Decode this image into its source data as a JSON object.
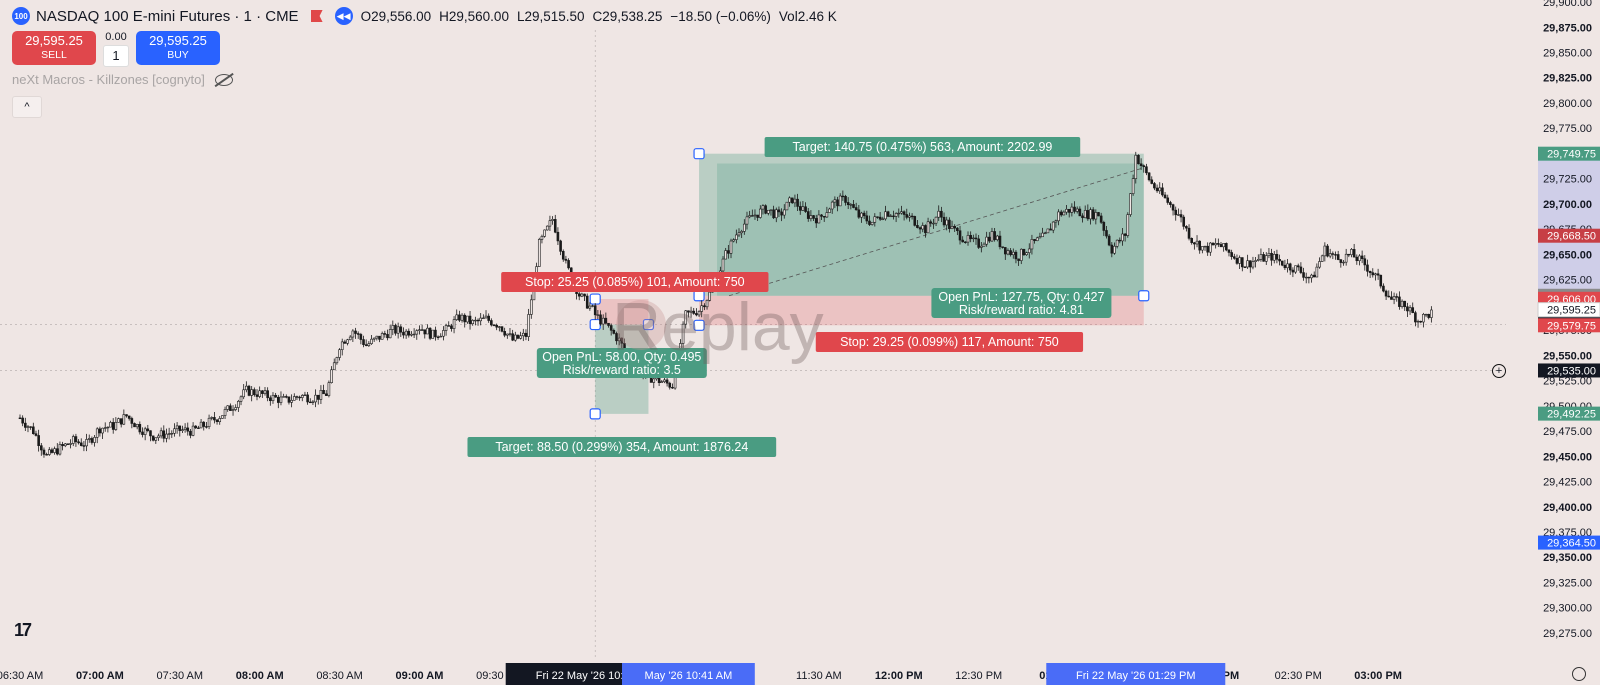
{
  "header": {
    "badge": "100",
    "symbol": "NASDAQ 100 E-mini Futures · 1 · CME",
    "open": "O29,556.00",
    "high": "H29,560.00",
    "low": "L29,515.50",
    "close": "C29,538.25",
    "change": "−18.50 (−0.06%)",
    "volume": "Vol2.46 K"
  },
  "trade_panel": {
    "sell_price": "29,595.25",
    "sell_label": "SELL",
    "spread": "0.00",
    "quantity": "1",
    "buy_price": "29,595.25",
    "buy_label": "BUY"
  },
  "indicator": {
    "name": "neXt Macros - Killzones [cognyto]"
  },
  "collapse_label": "^",
  "watermark": "Replay",
  "logo": "17",
  "colors": {
    "background": "#efe6e4",
    "up": "#1a1a1a",
    "target": "#4a9c82",
    "stop": "#e0474c",
    "accent": "#2962ff"
  },
  "chart_data": {
    "type": "candlestick",
    "y_ticks": [
      "29,900.00",
      "29,875.00",
      "29,850.00",
      "29,825.00",
      "29,800.00",
      "29,775.00",
      "29,750.00",
      "29,725.00",
      "29,700.00",
      "29,675.00",
      "29,650.00",
      "29,625.00",
      "29,600.00",
      "29,575.00",
      "29,550.00",
      "29,525.00",
      "29,500.00",
      "29,475.00",
      "29,450.00",
      "29,425.00",
      "29,400.00",
      "29,375.00",
      "29,350.00",
      "29,325.00",
      "29,300.00",
      "29,275.00"
    ],
    "y_tick_values": [
      29900,
      29875,
      29850,
      29825,
      29800,
      29775,
      29750,
      29725,
      29700,
      29675,
      29650,
      29625,
      29600,
      29575,
      29550,
      29525,
      29500,
      29475,
      29450,
      29425,
      29400,
      29375,
      29350,
      29325,
      29300,
      29275
    ],
    "y_tick_bold": [
      false,
      true,
      false,
      true,
      false,
      false,
      false,
      false,
      true,
      false,
      true,
      false,
      false,
      false,
      true,
      false,
      false,
      false,
      true,
      false,
      true,
      false,
      true,
      false,
      false,
      false
    ],
    "ylim": [
      29268,
      29902
    ],
    "x_ticks": [
      {
        "label": "06:30 AM",
        "t": "06:30",
        "bold": false
      },
      {
        "label": "07:00 AM",
        "t": "07:00",
        "bold": true
      },
      {
        "label": "07:30 AM",
        "t": "07:30",
        "bold": false
      },
      {
        "label": "08:00 AM",
        "t": "08:00",
        "bold": true
      },
      {
        "label": "08:30 AM",
        "t": "08:30",
        "bold": false
      },
      {
        "label": "09:00 AM",
        "t": "09:00",
        "bold": true
      },
      {
        "label": "09:30 AM",
        "t": "09:30",
        "bold": false
      },
      {
        "label": "M",
        "t": "11:00",
        "bold": false
      },
      {
        "label": "11:30 AM",
        "t": "11:30",
        "bold": false
      },
      {
        "label": "12:00 PM",
        "t": "12:00",
        "bold": true
      },
      {
        "label": "12:30 PM",
        "t": "12:30",
        "bold": false
      },
      {
        "label": "01:00 P",
        "t": "13:00",
        "bold": true
      },
      {
        "label": "2:00 PM",
        "t": "14:00",
        "bold": true
      },
      {
        "label": "02:30 PM",
        "t": "14:30",
        "bold": false
      },
      {
        "label": "03:00 PM",
        "t": "15:00",
        "bold": true
      }
    ],
    "x_highlights": [
      {
        "label": "Fri 22 May '26   10:06 AM",
        "t": "10:06",
        "style": "dark"
      },
      {
        "label": "May '26   10:41 AM",
        "t": "10:41",
        "style": "blue"
      },
      {
        "label": "Fri 22 May '26   01:29 PM",
        "t": "13:29",
        "style": "blue"
      }
    ],
    "price_path": [
      [
        "06:30",
        29488
      ],
      [
        "06:35",
        29475
      ],
      [
        "06:40",
        29450
      ],
      [
        "06:45",
        29458
      ],
      [
        "06:50",
        29465
      ],
      [
        "06:55",
        29462
      ],
      [
        "07:00",
        29478
      ],
      [
        "07:05",
        29480
      ],
      [
        "07:10",
        29490
      ],
      [
        "07:15",
        29478
      ],
      [
        "07:20",
        29470
      ],
      [
        "07:25",
        29472
      ],
      [
        "07:30",
        29476
      ],
      [
        "07:35",
        29475
      ],
      [
        "07:40",
        29482
      ],
      [
        "07:45",
        29490
      ],
      [
        "07:50",
        29500
      ],
      [
        "07:55",
        29515
      ],
      [
        "08:00",
        29512
      ],
      [
        "08:05",
        29508
      ],
      [
        "08:10",
        29505
      ],
      [
        "08:15",
        29510
      ],
      [
        "08:20",
        29508
      ],
      [
        "08:25",
        29512
      ],
      [
        "08:30",
        29560
      ],
      [
        "08:35",
        29575
      ],
      [
        "08:40",
        29560
      ],
      [
        "08:45",
        29568
      ],
      [
        "08:50",
        29575
      ],
      [
        "08:55",
        29573
      ],
      [
        "09:00",
        29578
      ],
      [
        "09:05",
        29570
      ],
      [
        "09:10",
        29575
      ],
      [
        "09:15",
        29588
      ],
      [
        "09:20",
        29582
      ],
      [
        "09:25",
        29586
      ],
      [
        "09:30",
        29580
      ],
      [
        "09:35",
        29565
      ],
      [
        "09:40",
        29570
      ],
      [
        "09:45",
        29660
      ],
      [
        "09:50",
        29685
      ],
      [
        "09:55",
        29640
      ],
      [
        "10:00",
        29610
      ],
      [
        "10:05",
        29595
      ],
      [
        "10:06",
        29590
      ],
      [
        "10:10",
        29580
      ],
      [
        "10:15",
        29565
      ],
      [
        "10:20",
        29540
      ],
      [
        "10:25",
        29530
      ],
      [
        "10:30",
        29525
      ],
      [
        "10:35",
        29520
      ],
      [
        "10:40",
        29590
      ],
      [
        "10:45",
        29595
      ],
      [
        "10:50",
        29615
      ],
      [
        "10:55",
        29650
      ],
      [
        "11:00",
        29675
      ],
      [
        "11:05",
        29688
      ],
      [
        "11:10",
        29695
      ],
      [
        "11:15",
        29688
      ],
      [
        "11:20",
        29705
      ],
      [
        "11:25",
        29690
      ],
      [
        "11:30",
        29685
      ],
      [
        "11:35",
        29700
      ],
      [
        "11:40",
        29705
      ],
      [
        "11:45",
        29688
      ],
      [
        "11:50",
        29682
      ],
      [
        "11:55",
        29692
      ],
      [
        "12:00",
        29690
      ],
      [
        "12:05",
        29685
      ],
      [
        "12:10",
        29675
      ],
      [
        "12:15",
        29690
      ],
      [
        "12:20",
        29675
      ],
      [
        "12:25",
        29665
      ],
      [
        "12:30",
        29660
      ],
      [
        "12:35",
        29670
      ],
      [
        "12:40",
        29655
      ],
      [
        "12:45",
        29648
      ],
      [
        "12:50",
        29660
      ],
      [
        "12:55",
        29668
      ],
      [
        "13:00",
        29690
      ],
      [
        "13:05",
        29695
      ],
      [
        "13:10",
        29690
      ],
      [
        "13:15",
        29690
      ],
      [
        "13:20",
        29655
      ],
      [
        "13:25",
        29670
      ],
      [
        "13:29",
        29748
      ],
      [
        "13:35",
        29720
      ],
      [
        "13:40",
        29705
      ],
      [
        "13:45",
        29690
      ],
      [
        "13:50",
        29665
      ],
      [
        "13:55",
        29655
      ],
      [
        "14:00",
        29660
      ],
      [
        "14:05",
        29650
      ],
      [
        "14:10",
        29640
      ],
      [
        "14:15",
        29645
      ],
      [
        "14:20",
        29648
      ],
      [
        "14:25",
        29640
      ],
      [
        "14:30",
        29635
      ],
      [
        "14:35",
        29625
      ],
      [
        "14:40",
        29655
      ],
      [
        "14:45",
        29645
      ],
      [
        "14:50",
        29650
      ],
      [
        "14:55",
        29640
      ],
      [
        "15:00",
        29625
      ],
      [
        "15:05",
        29605
      ],
      [
        "15:10",
        29600
      ],
      [
        "15:15",
        29585
      ],
      [
        "15:20",
        29592
      ]
    ],
    "price_labels": [
      {
        "text": "29,749.75",
        "value": 29749.75,
        "color": "#4a9c82"
      },
      {
        "text": "29,668.50",
        "value": 29668.5,
        "color": "#c73f45"
      },
      {
        "text": "29,609.00",
        "value": 29609,
        "color": "#8a8a8a"
      },
      {
        "text": "29,606.00",
        "value": 29606,
        "color": "#e0474c"
      },
      {
        "text": "29,595.25",
        "value": 29595.25,
        "color": "#ffffff",
        "text_color": "#131722"
      },
      {
        "text": "29,580.75",
        "value": 29580.75,
        "color": "#131722"
      },
      {
        "text": "29,579.75",
        "value": 29579.75,
        "color": "#e0474c"
      },
      {
        "text": "29,535.00",
        "value": 29535,
        "color": "#131722"
      },
      {
        "text": "29,492.25",
        "value": 29492.25,
        "color": "#4a9c82"
      },
      {
        "text": "29,364.50",
        "value": 29364.5,
        "color": "#2962ff"
      }
    ],
    "positions": [
      {
        "entry": 29580.5,
        "target": 29492.0,
        "stop": 29605.75,
        "t_start": "10:06",
        "t_end": "10:26",
        "target_label": "Target: 88.50 (0.299%) 354, Amount: 1876.24",
        "stop_label": "Stop: 25.25 (0.085%) 101, Amount: 750",
        "pnl_label": "Open PnL: 58.00, Qty: 0.495",
        "rr_label": "Risk/reward ratio: 3.5"
      },
      {
        "entry": 29609.0,
        "target": 29749.75,
        "stop": 29579.75,
        "t_start": "10:45",
        "t_end": "13:32",
        "target_label": "Target: 140.75 (0.475%) 563, Amount: 2202.99",
        "stop_label": "Stop: 29.25 (0.099%) 117, Amount: 750",
        "pnl_label": "Open PnL: 127.75, Qty: 0.427",
        "rr_label": "Risk/reward ratio: 4.81"
      }
    ]
  }
}
